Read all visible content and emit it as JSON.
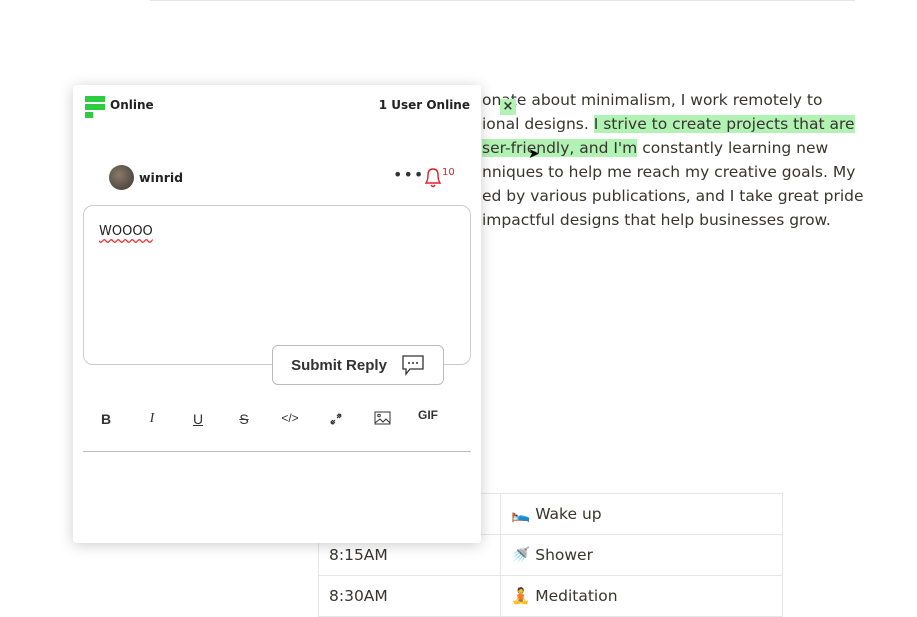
{
  "background": {
    "lines": [
      {
        "plain": "onate about minimalism, I work remotely to"
      },
      {
        "plain": "ional designs. ",
        "highlight": "I strive to create projects that are"
      },
      {
        "highlight": "ser-friendly, and I'm",
        "plain": " constantly learning new"
      },
      {
        "plain": "nniques to help me reach my creative goals. My"
      },
      {
        "plain": "ed by various publications, and I take great pride"
      },
      {
        "plain": " impactful designs that help businesses grow."
      }
    ],
    "highlight_close": "×",
    "highlight_color": "#b2f2b4",
    "table": [
      {
        "time": "",
        "activity": "🛌 Wake up"
      },
      {
        "time": "8:15AM",
        "activity": "🚿 Shower"
      },
      {
        "time": "8:30AM",
        "activity": "🧘 Meditation"
      }
    ]
  },
  "popup": {
    "status": "Online",
    "users_online": "1 User Online",
    "username": "winrid",
    "more": "•••",
    "notification_count": "10",
    "reply_text": "WOOOO",
    "submit_label": "Submit Reply",
    "toolbar": [
      "B",
      "I",
      "U",
      "S",
      "</>",
      "link",
      "image",
      "GIF"
    ],
    "accent": "#2ecc40",
    "alert_color": "#e0202a"
  }
}
